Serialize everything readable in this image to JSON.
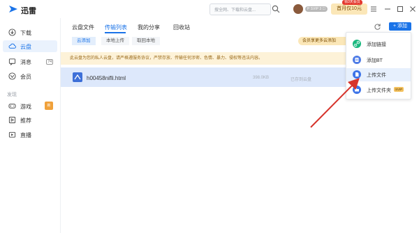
{
  "app": {
    "name": "迅雷"
  },
  "titlebar": {
    "search_placeholder": "搜全网、下载和云盘...",
    "vip_badge": "P SVIP 3 ☐",
    "promo_label": "首月仅10元",
    "promo_tag": "领3天会员"
  },
  "sidebar": {
    "items": [
      {
        "label": "下载",
        "icon": "download-icon"
      },
      {
        "label": "云盘",
        "icon": "cloud-icon",
        "active": true
      },
      {
        "label": "消息",
        "icon": "message-icon",
        "badge": "74"
      },
      {
        "label": "会员",
        "icon": "member-icon"
      }
    ],
    "section_label": "发现",
    "discover_items": [
      {
        "label": "游戏",
        "icon": "game-icon",
        "badge": "新"
      },
      {
        "label": "推荐",
        "icon": "recommend-icon"
      },
      {
        "label": "直播",
        "icon": "live-icon"
      }
    ]
  },
  "main": {
    "tabs": [
      "云盘文件",
      "传输列表",
      "我的分享",
      "回收站"
    ],
    "subtabs": [
      "云添加",
      "本地上传",
      "取回本地"
    ],
    "vip_pill": "会员享更多云添加",
    "add_label": "+ 添加",
    "notice": "此云盘为您的私人云盘，请严格遵服务协议，严禁存放、传输任何涉密、色情、暴力、侵权等违法内容。",
    "file": {
      "name": "h00458nifli.html",
      "size": "398.0KB",
      "status": "已存到云盘"
    }
  },
  "menu": {
    "items": [
      {
        "label": "添加链接",
        "icon": "link-icon"
      },
      {
        "label": "添加BT",
        "icon": "bt-file-icon"
      },
      {
        "label": "上传文件",
        "icon": "upload-file-icon",
        "hover": true
      },
      {
        "label": "上传文件夹",
        "icon": "upload-folder-icon",
        "tag": "SVIP"
      }
    ]
  },
  "colors": {
    "accent": "#1a73e8",
    "arrow": "#d6332b",
    "notice_bg": "#fdf2d8"
  }
}
